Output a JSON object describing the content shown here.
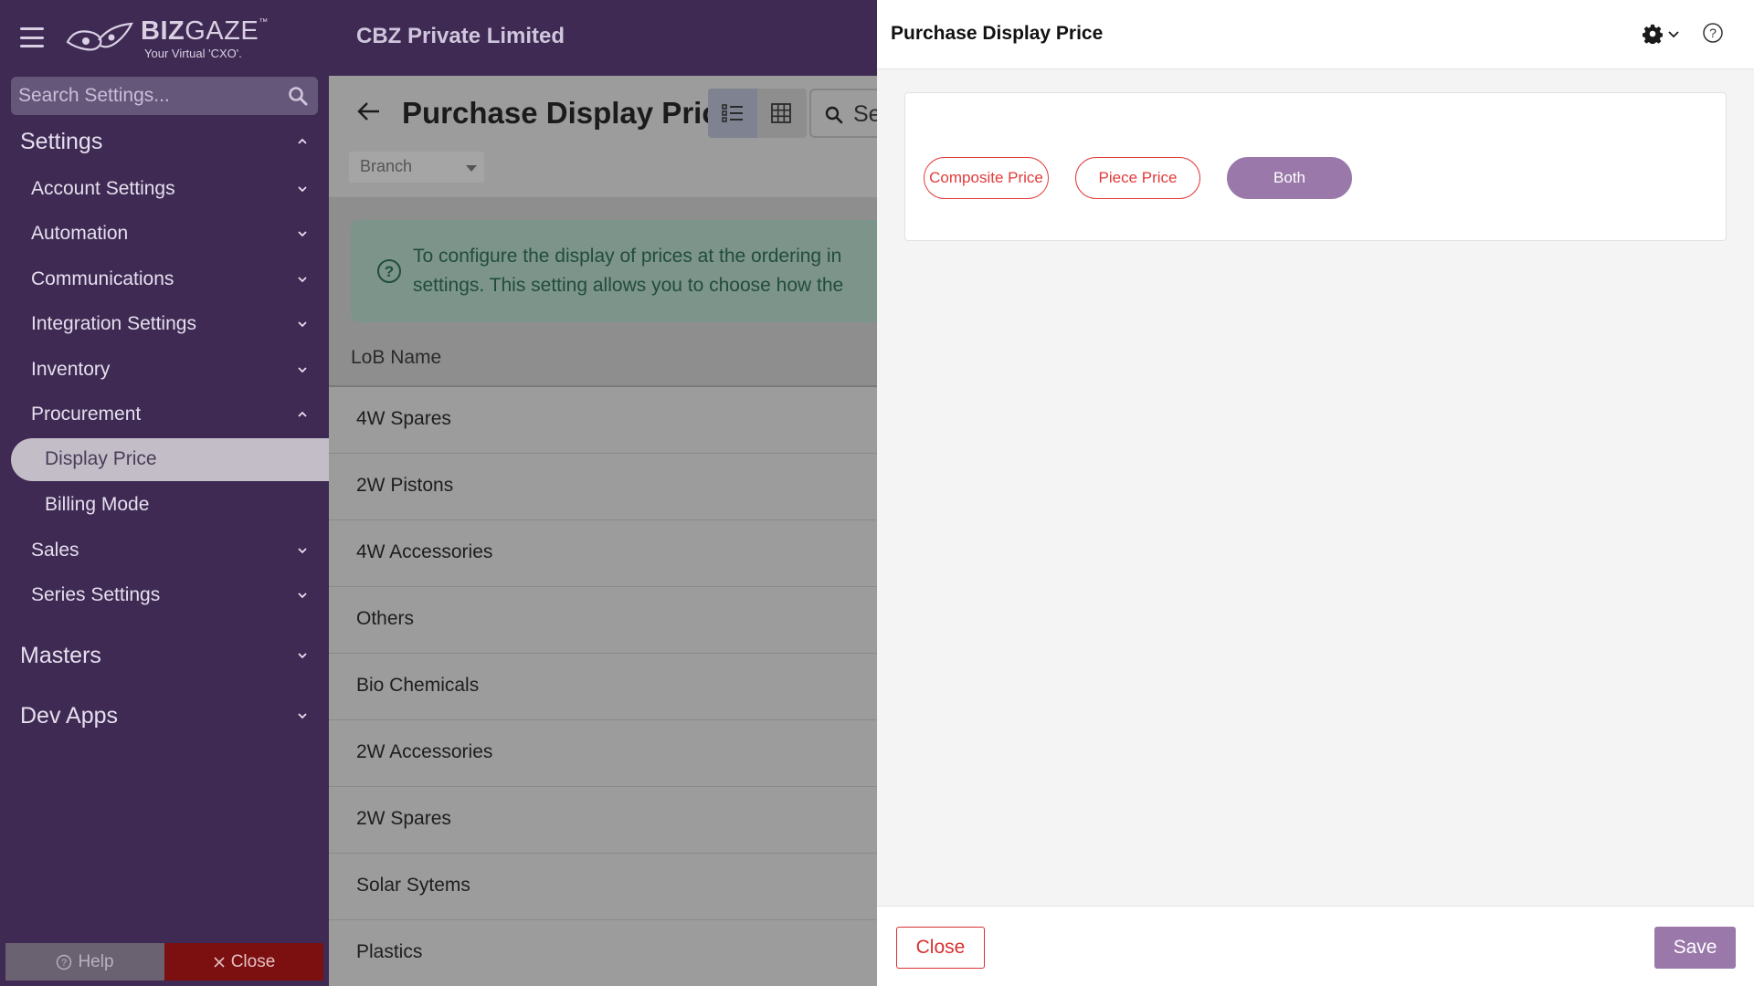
{
  "header": {
    "logo_brand": "BIZ",
    "logo_brand2": "GAZE",
    "logo_tm": "™",
    "logo_tagline": "Your Virtual 'CXO'.",
    "company": "CBZ Private Limited"
  },
  "sidebar": {
    "search_placeholder": "Search Settings...",
    "sections": {
      "settings": "Settings",
      "masters": "Masters",
      "dev_apps": "Dev Apps"
    },
    "items": {
      "account": "Account Settings",
      "automation": "Automation",
      "communications": "Communications",
      "integration": "Integration Settings",
      "inventory": "Inventory",
      "procurement": "Procurement",
      "display_price": "Display Price",
      "billing_mode": "Billing Mode",
      "sales": "Sales",
      "series": "Series Settings"
    },
    "help_label": "Help",
    "close_label": "Close"
  },
  "main": {
    "title": "Purchase Display Price",
    "search_partial": "Se",
    "branch_label": "Branch",
    "info_line1": "To configure the display of prices at the ordering in",
    "info_line2": "settings. This setting allows you to choose how the",
    "column_header": "LoB Name",
    "rows": [
      "4W Spares",
      "2W Pistons",
      "4W Accessories",
      "Others",
      "Bio Chemicals",
      "2W Accessories",
      "2W Spares",
      "Solar Sytems",
      "Plastics"
    ]
  },
  "modal": {
    "title": "Purchase Display Price",
    "options": {
      "composite": "Composite Price",
      "piece": "Piece Price",
      "both": "Both"
    },
    "selected": "Both",
    "close_label": "Close",
    "save_label": "Save"
  },
  "colors": {
    "sidebar_bg": "#3e2a52",
    "accent_purple": "#9a78aa",
    "danger_red": "#d93030",
    "close_bg": "#7c1010"
  }
}
